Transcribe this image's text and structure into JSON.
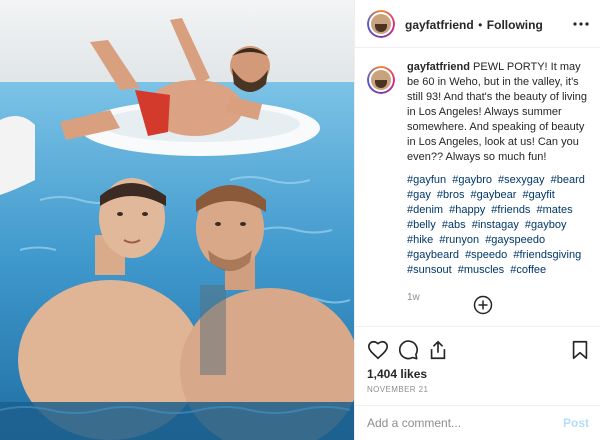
{
  "post": {
    "username": "gayfatfriend",
    "separator": "•",
    "follow_status": "Following",
    "caption_text": "PEWL PORTY! It may be 60 in Weho, but in the valley, it's still 93! And that's the beauty of living in Los Angeles! Always summer somewhere. And speaking of beauty in Los Angeles, look at us! Can you even?? Always so much fun!",
    "hashtags": [
      "#gayfun",
      "#gaybro",
      "#sexygay",
      "#beard",
      "#gay",
      "#bros",
      "#gaybear",
      "#gayfit",
      "#denim",
      "#happy",
      "#friends",
      "#mates",
      "#belly",
      "#abs",
      "#instagay",
      "#gayboy",
      "#hike",
      "#runyon",
      "#gayspeedo",
      "#gaybeard",
      "#speedo",
      "#friendsgiving",
      "#sunsout",
      "#muscles",
      "#coffee"
    ],
    "time_ago": "1w",
    "likes": "1,404 likes",
    "date": "NOVEMBER 21"
  },
  "comment": {
    "placeholder": "Add a comment...",
    "post_label": "Post"
  },
  "icons": {
    "more": "more-options-icon",
    "add": "add-circle-icon",
    "like": "heart-icon",
    "comment": "comment-icon",
    "share": "share-icon",
    "save": "bookmark-icon"
  },
  "colors": {
    "hashtag": "#00376b",
    "post_button_disabled": "#b2dffc",
    "muted": "#8e8e8e",
    "pool_water": "#4aa7d6"
  }
}
